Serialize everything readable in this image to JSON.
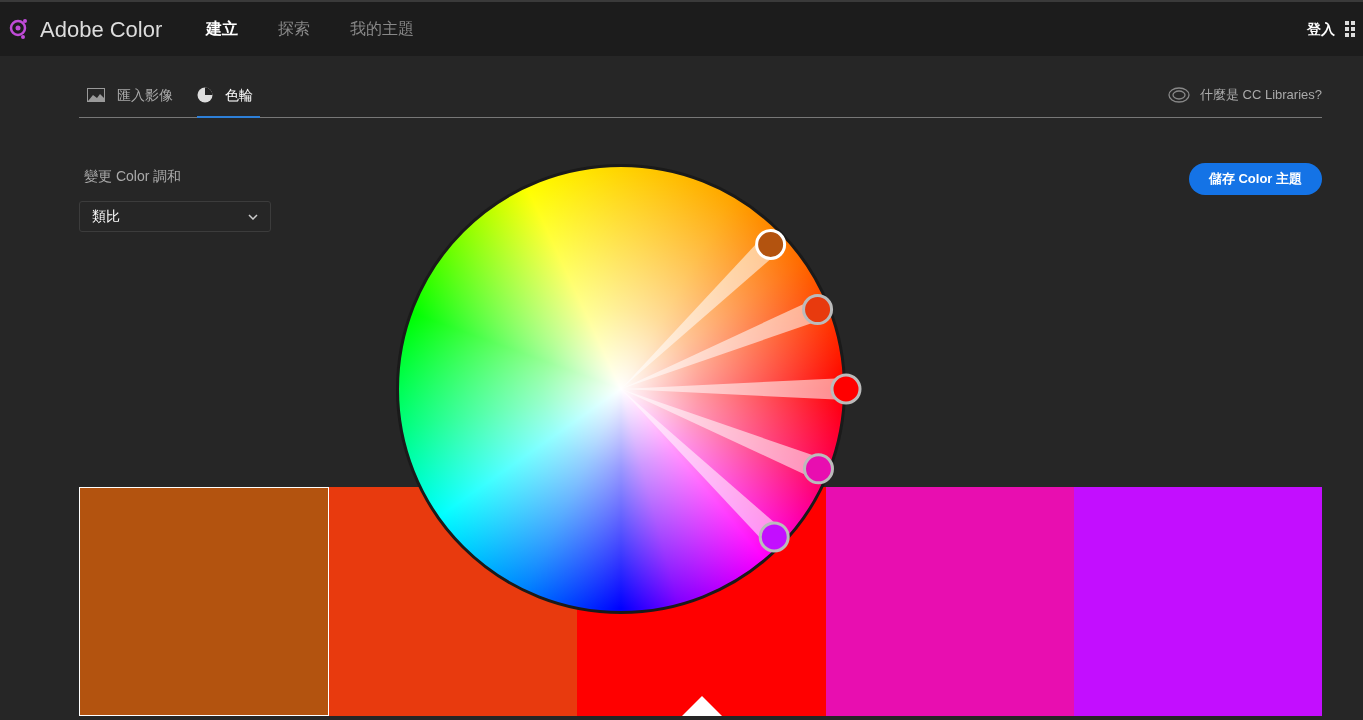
{
  "header": {
    "brand": "Adobe Color",
    "nav": [
      {
        "label": "建立",
        "selected": true
      },
      {
        "label": "探索",
        "selected": false
      },
      {
        "label": "我的主題",
        "selected": false
      }
    ],
    "signin": "登入"
  },
  "tabs": [
    {
      "kind": "image",
      "label": "匯入影像",
      "selected": false
    },
    {
      "kind": "wheel",
      "label": "色輪",
      "selected": true
    }
  ],
  "cc_link": "什麼是 CC Libraries?",
  "harmony": {
    "label": "變更 Color 調和",
    "value": "類比"
  },
  "save_button": "儲存 Color 主題",
  "swatches": [
    {
      "color": "#b3530f",
      "selected": true,
      "base": false
    },
    {
      "color": "#e83a0e",
      "selected": false,
      "base": false
    },
    {
      "color": "#ff0000",
      "selected": false,
      "base": true
    },
    {
      "color": "#e80eb0",
      "selected": false,
      "base": false
    },
    {
      "color": "#c30eff",
      "selected": false,
      "base": false
    }
  ]
}
